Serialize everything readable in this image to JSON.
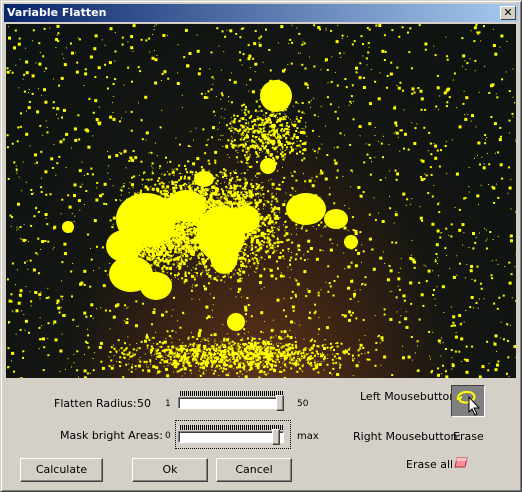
{
  "window": {
    "title": "Variable Flatten",
    "close_glyph": "✕"
  },
  "image": {
    "description_icon": "star-field-mask-preview",
    "mask_color": "#ffff00"
  },
  "flatten_radius": {
    "label": "Flatten Radius:",
    "value": "50",
    "min_label": "1",
    "max_label": "50",
    "level": 1.0
  },
  "mask_bright": {
    "label": "Mask bright Areas:",
    "min_label": "0",
    "max_label": "max",
    "level": 0.96
  },
  "mouse": {
    "left_label": "Left Mousebutton:",
    "right_label": "Right Mousebutton:",
    "right_value": "Erase",
    "left_tool_icon": "lasso-cursor-icon"
  },
  "erase_all": {
    "label": "Erase all",
    "icon": "eraser-icon"
  },
  "buttons": {
    "calculate": "Calculate",
    "ok": "Ok",
    "cancel": "Cancel"
  }
}
